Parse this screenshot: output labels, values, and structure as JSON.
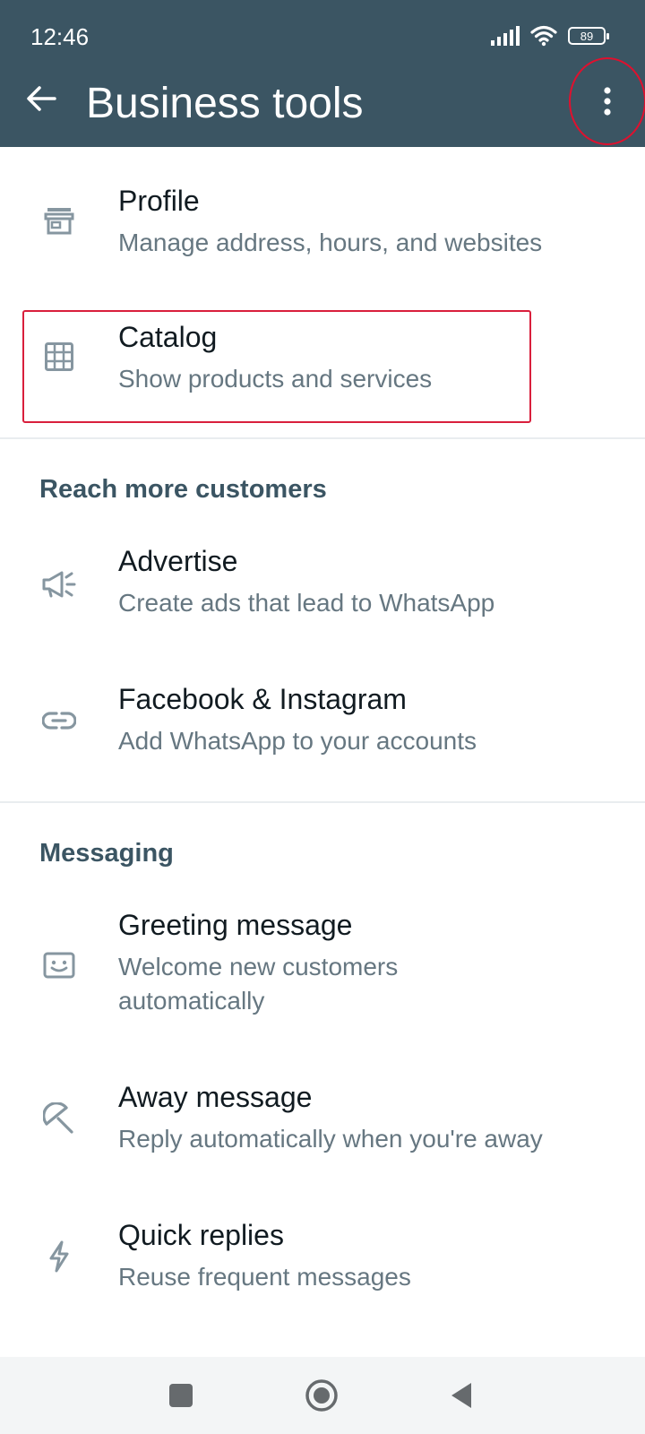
{
  "status_bar": {
    "time": "12:46",
    "battery": "89"
  },
  "header": {
    "title": "Business tools"
  },
  "items": {
    "profile": {
      "title": "Profile",
      "subtitle": "Manage address, hours, and websites",
      "icon": "storefront-icon"
    },
    "catalog": {
      "title": "Catalog",
      "subtitle": "Show products and services",
      "icon": "grid-icon"
    },
    "advertise": {
      "title": "Advertise",
      "subtitle": "Create ads that lead to WhatsApp",
      "icon": "megaphone-icon"
    },
    "facebook_instagram": {
      "title": "Facebook & Instagram",
      "subtitle": "Add WhatsApp to your accounts",
      "icon": "link-icon"
    },
    "greeting": {
      "title": "Greeting message",
      "subtitle": "Welcome new customers automatically",
      "icon": "greeting-icon"
    },
    "away": {
      "title": "Away message",
      "subtitle": "Reply automatically when you're away",
      "icon": "away-icon"
    },
    "quick_replies": {
      "title": "Quick replies",
      "subtitle": "Reuse frequent messages",
      "icon": "lightning-icon"
    }
  },
  "sections": {
    "reach": "Reach more customers",
    "messaging": "Messaging"
  },
  "colors": {
    "appbar": "#3b5563",
    "accent_highlight": "#d91f3c",
    "title_text": "#111b21",
    "subtitle_text": "#667781"
  }
}
